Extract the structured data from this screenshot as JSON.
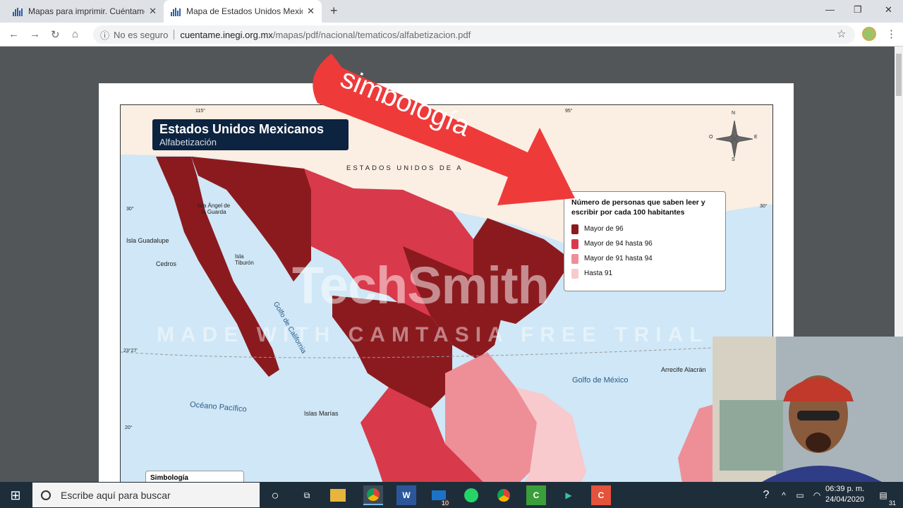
{
  "browser": {
    "tabs": [
      {
        "title": "Mapas para imprimir. Cuéntame",
        "active": false
      },
      {
        "title": "Mapa de Estados Unidos Mexicanos",
        "active": true
      }
    ],
    "new_tab": "+",
    "security": "No es seguro",
    "url_domain": "cuentame.inegi.org.mx",
    "url_path": "/mapas/pdf/nacional/tematicos/alfabetizacion.pdf"
  },
  "map": {
    "title": "Estados Unidos Mexicanos",
    "subtitle": "Alfabetización",
    "country_label": "ESTADOS UNIDOS DE A",
    "labels": {
      "lon115": "115°",
      "lon95": "95°",
      "lat30": "30°",
      "lat30r": "30°",
      "lat20": "20°",
      "tropic": "23°27'",
      "isla_angel": "Isla Ángel de la Guarda",
      "isla_guadalupe": "Isla Guadalupe",
      "cedros": "Cedros",
      "isla_tiburon": "Isla Tiburón",
      "golfo_california": "Golfo de California",
      "oceano": "Océano Pacífico",
      "islas_marias": "Islas Marías",
      "golfo_mexico": "Golfo de México",
      "arrecife": "Arrecife Alacrán",
      "n": "N",
      "s": "S",
      "e": "E",
      "o": "O"
    },
    "legend": {
      "heading": "Número de personas que saben leer y escribir por cada 100 habitantes",
      "items": [
        {
          "label": "Mayor de 96",
          "color": "#8b1a1f"
        },
        {
          "label": "Mayor de 94 hasta 96",
          "color": "#d83a4b"
        },
        {
          "label": "Mayor de 91 hasta 94",
          "color": "#ee8f97"
        },
        {
          "label": "Hasta 91",
          "color": "#f8c9cd"
        }
      ]
    },
    "symbology_box": "Simbología"
  },
  "overlay": {
    "arrow_text": "simbología",
    "watermark_brand": "TechSmith",
    "watermark_trial": "MADE WITH CAMTASIA FREE TRIAL"
  },
  "taskbar": {
    "search_placeholder": "Escribe aquí para buscar",
    "time": "06:39 p. m.",
    "date": "24/04/2020",
    "mail_badge": "10",
    "notif_badge": "31"
  }
}
